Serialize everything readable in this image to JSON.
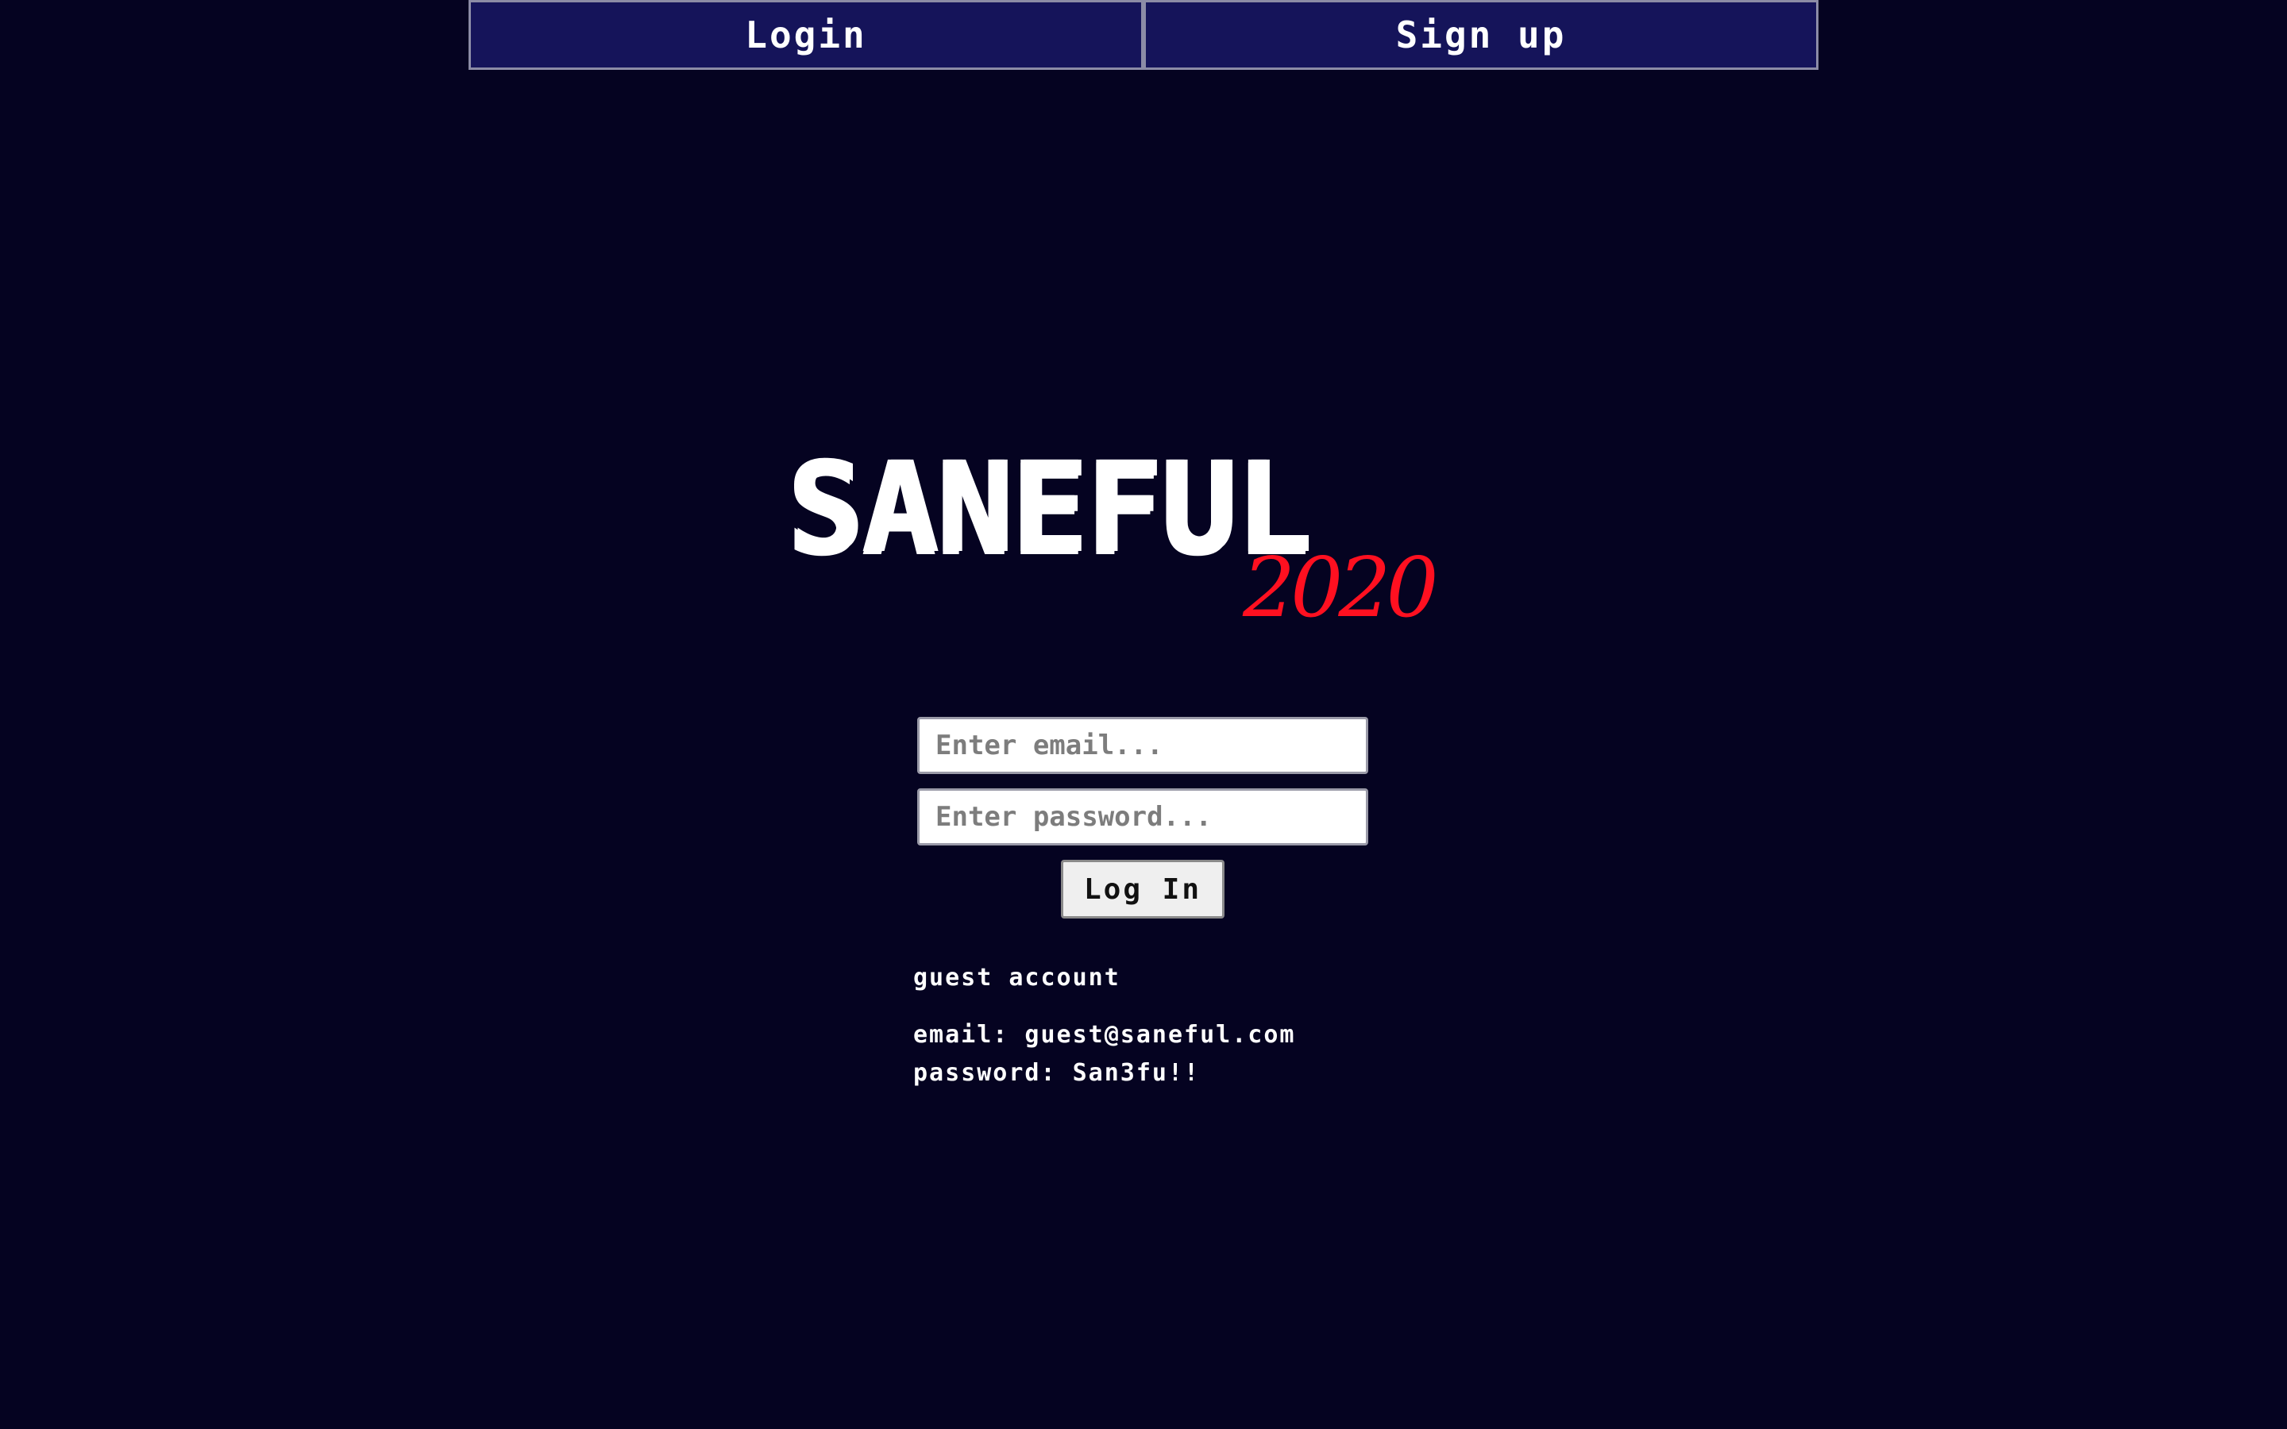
{
  "tabs": {
    "login_label": "Login",
    "signup_label": "Sign up"
  },
  "logo": {
    "main": "SANEFUL",
    "sub": "2020"
  },
  "form": {
    "email_placeholder": "Enter email...",
    "password_placeholder": "Enter password...",
    "submit_label": "Log In"
  },
  "guest": {
    "title": "guest account",
    "email_line": "email: guest@saneful.com",
    "password_line": "password: San3fu!!"
  },
  "colors": {
    "background": "#050321",
    "tab_background": "#15145a",
    "logo_accent": "#ff1020"
  }
}
